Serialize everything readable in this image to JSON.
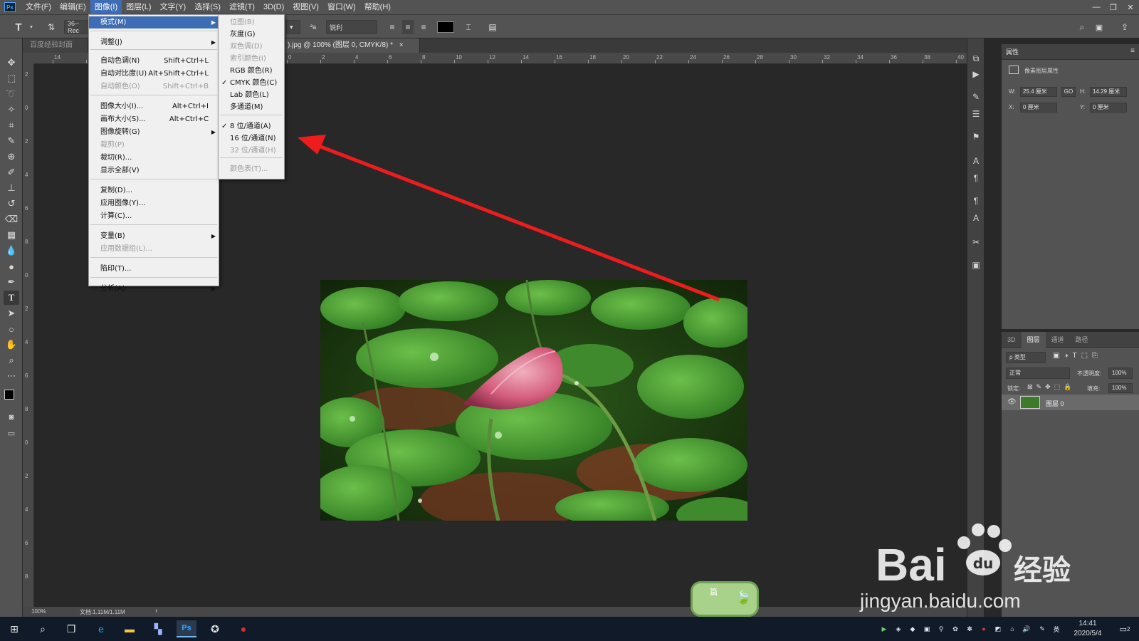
{
  "app": {
    "name": "Ps",
    "accent": "#3e6cb5",
    "window_controls": [
      "—",
      "❐",
      "✕"
    ]
  },
  "menubar": {
    "items": [
      "文件(F)",
      "编辑(E)",
      "图像(I)",
      "图层(L)",
      "文字(Y)",
      "选择(S)",
      "滤镜(T)",
      "3D(D)",
      "视图(V)",
      "窗口(W)",
      "帮助(H)"
    ],
    "active_index": 2
  },
  "options": {
    "tool_icon": "T",
    "font_size_field": "36-- Rec",
    "anti_alias": "锐利",
    "antialias_icon": "ªa",
    "text_color": "#000000"
  },
  "tabs": [
    {
      "label": "百度经验封面1.psd"
    },
    {
      "label": ").jpg @ 100% (图层 0, CMYK/8) *"
    }
  ],
  "tab_close": "×",
  "ruler": {
    "h_ticks": [
      "14",
      "12",
      "10",
      "8",
      "6",
      "4",
      "2",
      "0",
      "2",
      "4",
      "6",
      "8",
      "10",
      "12",
      "14",
      "16",
      "18",
      "20",
      "22",
      "24",
      "26",
      "28",
      "30",
      "32",
      "34",
      "36",
      "38",
      "40"
    ],
    "v_ticks": [
      "2",
      "0",
      "2",
      "4",
      "6",
      "8",
      "0",
      "2",
      "4",
      "6",
      "8",
      "0",
      "2",
      "4",
      "6",
      "8"
    ]
  },
  "status": {
    "zoom": "100%",
    "doc_info": "文档:1.11M/1.11M",
    "arrow": "›"
  },
  "image_menu": {
    "items": [
      {
        "label": "模式(M)",
        "submenu": true,
        "highlighted": true
      },
      {
        "label": "调整(J)",
        "submenu": true
      },
      {
        "label": "自动色调(N)",
        "shortcut": "Shift+Ctrl+L"
      },
      {
        "label": "自动对比度(U)",
        "shortcut": "Alt+Shift+Ctrl+L"
      },
      {
        "label": "自动颜色(O)",
        "shortcut": "Shift+Ctrl+B",
        "disabled": true
      },
      {
        "label": "图像大小(I)...",
        "shortcut": "Alt+Ctrl+I"
      },
      {
        "label": "画布大小(S)...",
        "shortcut": "Alt+Ctrl+C"
      },
      {
        "label": "图像旋转(G)",
        "submenu": true
      },
      {
        "label": "裁剪(P)",
        "disabled": true
      },
      {
        "label": "裁切(R)..."
      },
      {
        "label": "显示全部(V)"
      },
      {
        "label": "复制(D)..."
      },
      {
        "label": "应用图像(Y)..."
      },
      {
        "label": "计算(C)..."
      },
      {
        "label": "变量(B)",
        "submenu": true
      },
      {
        "label": "应用数据组(L)...",
        "disabled": true
      },
      {
        "label": "陷印(T)..."
      },
      {
        "label": "分析(A)",
        "submenu": true
      }
    ]
  },
  "mode_menu": {
    "items": [
      {
        "label": "位图(B)",
        "disabled": true
      },
      {
        "label": "灰度(G)"
      },
      {
        "label": "双色调(D)",
        "disabled": true
      },
      {
        "label": "索引颜色(I)",
        "disabled": true
      },
      {
        "label": "RGB 颜色(R)"
      },
      {
        "label": "CMYK 颜色(C)",
        "checked": true
      },
      {
        "label": "Lab 颜色(L)"
      },
      {
        "label": "多通道(M)"
      },
      {
        "label": "8 位/通道(A)",
        "checked": true
      },
      {
        "label": "16 位/通道(N)"
      },
      {
        "label": "32 位/通道(H)",
        "disabled": true
      },
      {
        "label": "颜色表(T)...",
        "disabled": true
      }
    ],
    "check_glyph": "✓",
    "submenu_glyph": "▶"
  },
  "properties": {
    "tab": "属性",
    "title": "像素图层属性",
    "w_label": "W:",
    "w": "25.4 厘米",
    "link": "GO",
    "h_label": "H:",
    "h": "14.29 厘米",
    "x_label": "X:",
    "x": "0 厘米",
    "y_label": "Y:",
    "y": "0 厘米"
  },
  "layers": {
    "tabs": [
      "3D",
      "图层",
      "通道",
      "路径"
    ],
    "active_tab": 1,
    "filter": "ρ 类型",
    "blend_mode": "正常",
    "opacity_label": "不透明度:",
    "opacity": "100%",
    "lock_label": "锁定:",
    "fill_label": "填充:",
    "fill": "100%",
    "layer_name": "图层 0"
  },
  "taskbar": {
    "time": "14:41",
    "date": "2020/5/4",
    "ime": "英",
    "notify_count": "2"
  },
  "watermark": {
    "brand_left": "Bai",
    "brand_right": "经验",
    "url": "jingyan.baidu.com",
    "badge": "篇"
  },
  "annotation": {
    "arrow_color": "#ee1c1c"
  }
}
